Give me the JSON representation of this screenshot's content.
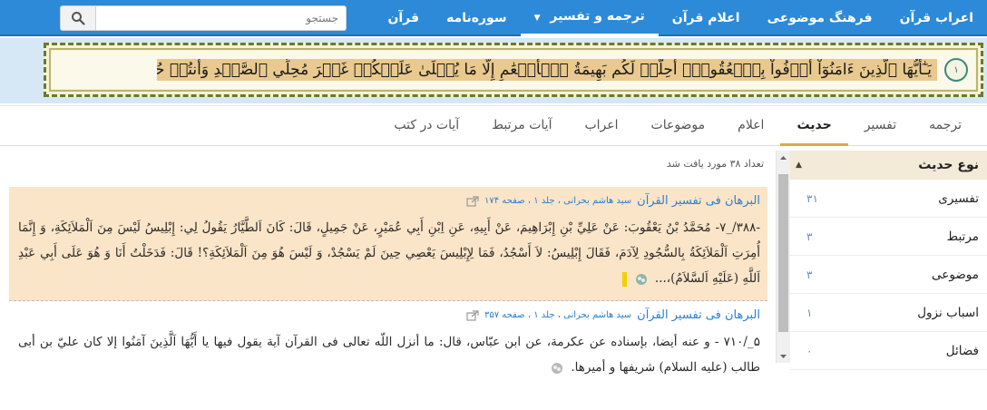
{
  "nav": {
    "items": [
      {
        "label": "قرآن",
        "active": false
      },
      {
        "label": "سوره‌نامه",
        "active": false
      },
      {
        "label": "ترجمه و تفسیر",
        "active": true,
        "dropdown": true
      },
      {
        "label": "اعلام قرآن",
        "active": false
      },
      {
        "label": "فرهنگ موضوعی",
        "active": false
      },
      {
        "label": "اعراب قرآن",
        "active": false
      }
    ]
  },
  "search": {
    "placeholder": "جستجو",
    "icon": "search-icon"
  },
  "verse": {
    "text": "يَـٰٓأَيُّهَا ٱلَّذِينَ ءَامَنُوٓاْ أَوۡفُواْ بِٱلۡعُقُودِۚ أُحِلَّتۡ لَكُم بَهِيمَةُ ٱلۡأَنۡعَٰمِ إِلَّا مَا يُتۡلَىٰ عَلَيۡكُمۡ غَيۡرَ مُحِلِّي ٱلصَّيۡدِ وَأَنتُمۡ حُرُمٌۗ إِنَّ ٱللَّهَ يَحۡكُمُ مَا يُرِيدُ",
    "number": "١"
  },
  "tabs": [
    {
      "label": "ترجمه",
      "active": false
    },
    {
      "label": "تفسیر",
      "active": false
    },
    {
      "label": "حدیث",
      "active": true
    },
    {
      "label": "اعلام",
      "active": false
    },
    {
      "label": "موضوعات",
      "active": false
    },
    {
      "label": "اعراب",
      "active": false
    },
    {
      "label": "آیات مرتبط",
      "active": false
    },
    {
      "label": "آیات در کتب",
      "active": false
    }
  ],
  "results": {
    "count_text": "تعداد ۳۸ مورد یافت شد",
    "hadiths": [
      {
        "book": "البرهان فی تفسیر القرآن",
        "meta": "سید هاشم بحرانی ، جلد ۱ ، صفحه ۱۷۴",
        "body": "-۳۸۸/_۷- مُحَمَّدُ بْنُ يَعْقُوبَ: عَنْ عَلِيِّ بْنِ إِبْرَاهِيمَ، عَنْ أَبِيهِ، عَنِ اِبْنِ أَبِي عُمَيْرٍ، عَنْ جَمِيلٍ، قَالَ: كَانَ اَلطَّيَّارُ يَقُولُ لِي: إِبْلِيسُ لَيْسَ مِنَ اَلْمَلاَئِكَةِ، وَ إِنَّمَا أُمِرَتِ اَلْمَلاَئِكَةُ بِالسُّجُودِ لِآدَمَ، فَقَالَ إِبْلِيسُ: لاَ أَسْجُدُ، فَمَا لِإِبْلِيسَ يَعْصِي حِينَ لَمْ يَسْجُدْ، وَ لَيْسَ هُوَ مِنَ اَلْمَلاَئِكَةِ؟! قَالَ: فَدَخَلْتُ أَنَا وَ هُوَ عَلَى أَبِي عَبْدِ اَللَّهِ (عَلَيْهِ اَلسَّلاَمُ)،...",
        "highlight": true
      },
      {
        "book": "البرهان فی تفسیر القرآن",
        "meta": "سید هاشم بحرانی ، جلد ۱ ، صفحه ۳۵۷",
        "body": "۵_/۷۱۰ - و عنه أيضا، بإسناده عن عكرمة، عن ابن عبّاس، قال: ما أنزل اللّه تعالى فى القرآن آية يقول فيها يا أَيُّهَا اَلَّذِينَ آمَنُوا إلا كان عليّ بن أبى طالب (عليه السلام) شريفها و أميرها.",
        "highlight": false
      }
    ]
  },
  "sidebar": {
    "title": "نوع حدیث",
    "items": [
      {
        "label": "تفسیری",
        "count": "۳۱"
      },
      {
        "label": "مرتبط",
        "count": "۳"
      },
      {
        "label": "موضوعی",
        "count": "۳"
      },
      {
        "label": "اسباب نزول",
        "count": "۱"
      },
      {
        "label": "فضائل",
        "count": "۰"
      }
    ]
  },
  "colors": {
    "nav_bg": "#2d8ad8",
    "accent": "#e0a84a",
    "link": "#2a7fd0",
    "highlight_bg": "#fbe5c8"
  }
}
